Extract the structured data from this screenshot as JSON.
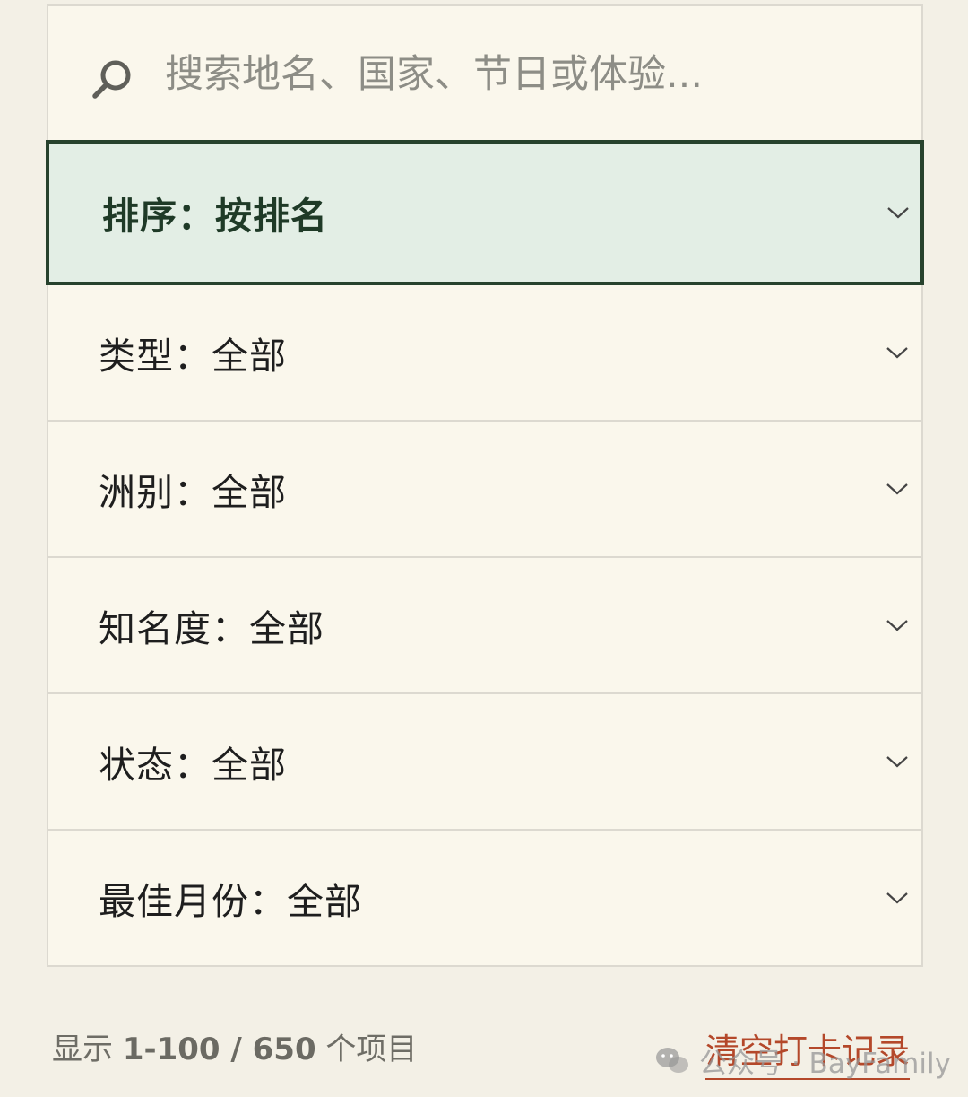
{
  "search": {
    "placeholder": "搜索地名、国家、节日或体验..."
  },
  "filters": [
    {
      "label": "排序：按排名",
      "active": true
    },
    {
      "label": "类型：全部",
      "active": false
    },
    {
      "label": "洲别：全部",
      "active": false
    },
    {
      "label": "知名度：全部",
      "active": false
    },
    {
      "label": "状态：全部",
      "active": false
    },
    {
      "label": "最佳月份：全部",
      "active": false
    }
  ],
  "footer": {
    "count_prefix": "显示 ",
    "count_range": "1-100 / 650",
    "count_suffix": " 个项目",
    "clear_label": "清空打卡记录"
  },
  "watermark": {
    "text": "公众号 · BayFamily",
    "icon": "wechat-icon"
  },
  "colors": {
    "accent": "#27422d",
    "active_bg": "#e3eee5",
    "link": "#b4482a",
    "panel_bg": "#faf7ec",
    "page_bg": "#f3f0e6"
  }
}
